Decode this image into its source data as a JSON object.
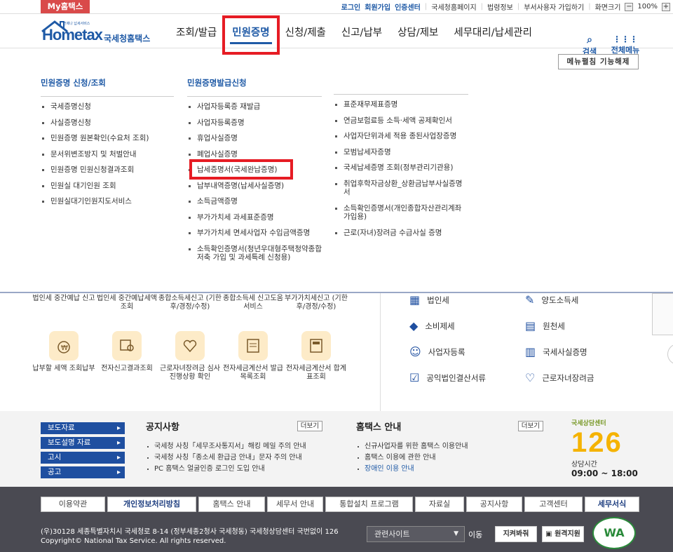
{
  "topbar": {
    "my_hometax": "My홈택스",
    "links": [
      "로그인",
      "회원가입",
      "인증센터",
      "국세청홈페이지",
      "법령정보",
      "부서사용자 가입하기",
      "화면크기"
    ],
    "zoom": "100%",
    "zoom_out": "−",
    "zoom_in": "+"
  },
  "header": {
    "logo_small": "언제나 납세서비스",
    "logo_main": "Hometax",
    "logo_sub": "국세청홈택스",
    "nav": [
      "조회/발급",
      "민원증명",
      "신청/제출",
      "신고/납부",
      "상담/제보",
      "세무대리/납세관리"
    ],
    "search_label": "검색",
    "allmenu_label": "전체메뉴"
  },
  "megamenu": {
    "close_button": "메뉴펼침 기능해제",
    "col1": {
      "title": "민원증명 신청/조회",
      "items": [
        "국세증명신청",
        "사실증명신청",
        "민원증명 원본확인(수요처 조회)",
        "문서위변조방지 및 처벌안내",
        "민원증명 민원신청결과조회",
        "민원실 대기인원 조회",
        "민원실대기인원지도서비스"
      ]
    },
    "col2": {
      "title": "민원증명발급신청",
      "items": [
        "사업자등록증 재발급",
        "사업자등록증명",
        "휴업사실증명",
        "폐업사실증명",
        "납세증명서(국세완납증명)",
        "납부내역증명(납세사실증명)",
        "소득금액증명",
        "부가가치세 과세표준증명",
        "부가가치세 면세사업자 수입금액증명",
        "소득확인증명서(청년우대형주택청약종합저축 가입 및 과세특례 신청용)"
      ]
    },
    "col3": {
      "items": [
        "표준재무제표증명",
        "연금보험료등 소득·세액 공제확인서",
        "사업자단위과세 적용 종된사업장증명",
        "모범납세자증명",
        "국세납세증명 조회(정부관리기관용)",
        "취업후학자금상환_상환금납부사실증명서",
        "소득확인증명서(개인종합자산관리계좌 가입용)",
        "근로(자녀)장려금 수급사실 증명"
      ]
    }
  },
  "services": {
    "row1": [
      "법인세 중간예납 신고",
      "법인세 중간예납세액 조회",
      "종합소득세신고 (기한후/경정/수정)",
      "종합소득세 신고도움 서비스",
      "부가가치세신고 (기한후/경정/수정)"
    ],
    "row2": [
      "납부할 세액 조회납부",
      "전자신고결과조회",
      "근로자녀장려금 심사진행상황 확인",
      "전자세금계산서 발급목록조회",
      "전자세금계산서 합계표조회"
    ]
  },
  "right_services": [
    "법인세",
    "양도소득세",
    "소비제세",
    "원천세",
    "사업자등록",
    "국세사실증명",
    "공익법인결산서류",
    "근로자녀장려금"
  ],
  "notice": {
    "left_buttons": [
      "보도자료",
      "보도설명 자료",
      "고시",
      "공고"
    ],
    "notice_title": "공지사항",
    "notice_more": "더보기",
    "notice_items": [
      "국세청 사칭「세무조사통지서」해킹 메일 주의 안내",
      "국세청 사칭「종소세 환급금 안내」문자 주의 안내",
      "PC 홈택스 얼굴인증 로그인 도입 안내"
    ],
    "guide_title": "홈택스 안내",
    "guide_more": "더보기",
    "guide_items": [
      "신규사업자를 위한 홈택스 이용안내",
      "홈택스 이용에 관한 안내",
      "장애인 이용 안내"
    ],
    "center_label": "국세상담센터",
    "center_number": "126",
    "center_hours_label": "상담시간",
    "center_hours": "09:00 ~ 18:00"
  },
  "footer": {
    "links": [
      "이용약관",
      "개인정보처리방침",
      "홈택스 안내",
      "세무서 안내",
      "통합설치 프로그램",
      "자료실",
      "공지사항",
      "고객센터",
      "세무서식"
    ],
    "address": "(우)30128 세종특별자치시 국세청로 8-14 (정부세종2청사 국세청동) 국세청상담센터 국번없이 126",
    "copyright": "Copyright© National Tax Service. All rights reserved.",
    "related_sites": "관련사이트",
    "move": "이동",
    "btn1": "지켜봐줘",
    "btn2": "원격지원",
    "wa_badge": "WA"
  },
  "colors": {
    "accent": "#1f5aa6",
    "highlight": "#e61c24",
    "footer_bg": "#4a4a52"
  }
}
